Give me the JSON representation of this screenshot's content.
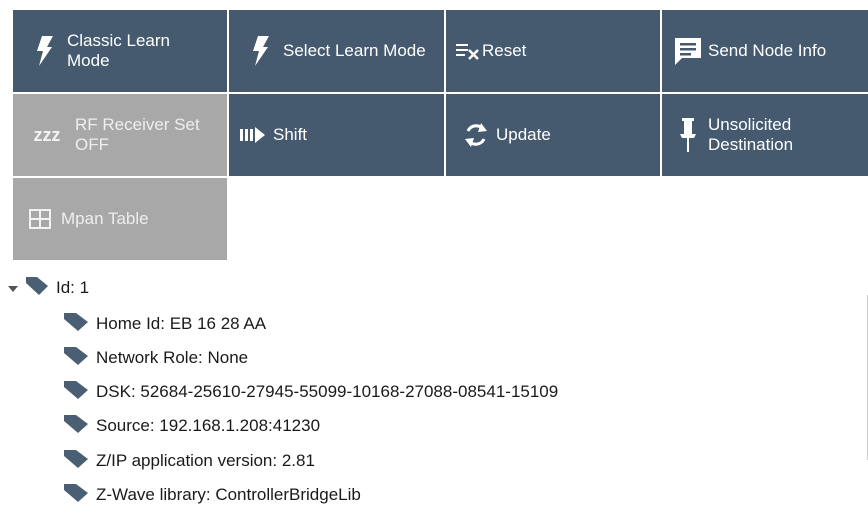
{
  "toolbar": {
    "classic_learn": "Classic Learn Mode",
    "select_learn": "Select Learn Mode",
    "reset": "Reset",
    "send_node_info": "Send Node Info",
    "rf_receiver": "RF Receiver Set OFF",
    "rf_receiver_icon_text": "zzz",
    "shift": "Shift",
    "update": "Update",
    "unsolicited": "Unsolicited Destination",
    "mpan_table": "Mpan Table"
  },
  "tree": {
    "root": "Id: 1",
    "items": [
      "Home Id: EB 16 28 AA",
      "Network Role: None",
      "DSK: 52684-25610-27945-55099-10168-27088-08541-15109",
      "Source: 192.168.1.208:41230",
      "Z/IP application version: 2.81",
      "Z-Wave library: ControllerBridgeLib"
    ]
  },
  "colors": {
    "tile_dark": "#455a6f",
    "tile_disabled": "#a8a8a8",
    "tag_icon": "#4a5f74"
  },
  "icons": [
    "lightning-icon",
    "reset-icon",
    "message-icon",
    "sleep-icon",
    "shift-icon",
    "refresh-icon",
    "pin-icon",
    "table-icon",
    "tag-icon",
    "collapse-arrow-icon"
  ]
}
